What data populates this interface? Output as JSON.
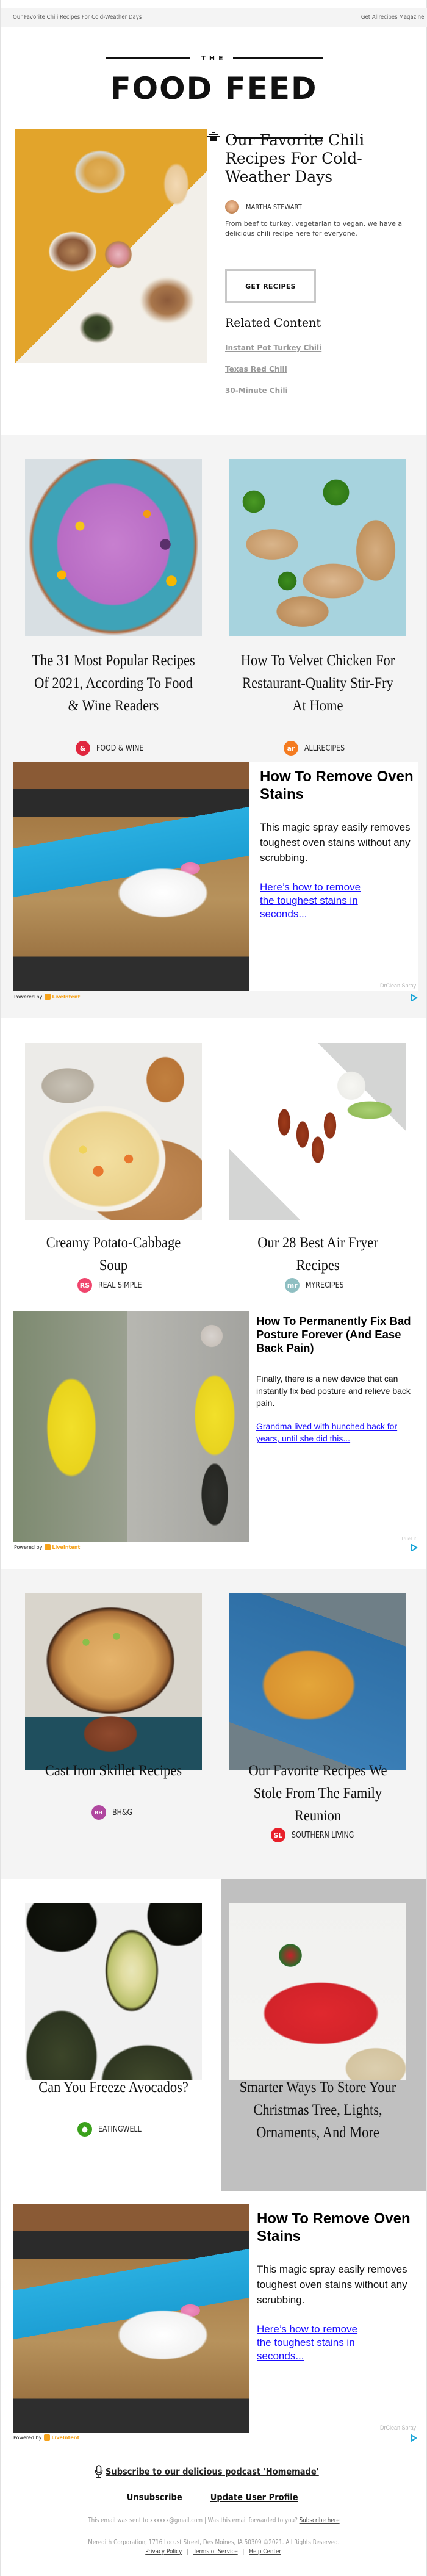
{
  "preheader": {
    "left_link": "Our Favorite Chili Recipes For Cold-Weather Days",
    "right_link": "Get Allrecipes Magazine"
  },
  "logo": {
    "the": "THE",
    "title": "FOOD FEED",
    "icon": "cooking-pot-icon"
  },
  "hero": {
    "title": "Our Favorite Chili Recipes For Cold-Weather Days",
    "author": "MARTHA STEWART",
    "description": "From beef to turkey, vegetarian to vegan, we have a delicious chili recipe here for everyone.",
    "cta": "GET RECIPES",
    "related_title": "Related Content",
    "related_links": [
      "Instant Pot Turkey Chili",
      "Texas Red Chili",
      "30-Minute Chili"
    ]
  },
  "cards": [
    {
      "title": "The 31 Most Popular Recipes Of 2021, According To Food & Wine Readers",
      "source": "FOOD & WINE",
      "source_icon_text": "&",
      "source_color": "#e0263e"
    },
    {
      "title": "How To Velvet Chicken For Restaurant-Quality Stir-Fry At Home",
      "source": "ALLRECIPES",
      "source_icon_text": "ar",
      "source_color": "#f47b20"
    },
    {
      "title": "Creamy Potato-Cabbage Soup",
      "source": "REAL SIMPLE",
      "source_icon_text": "RS",
      "source_color": "#f0456d"
    },
    {
      "title": "Our 28 Best Air Fryer Recipes",
      "source": "MYRECIPES",
      "source_icon_text": "mr",
      "source_color": "#8fbfc2"
    },
    {
      "title": "Cast Iron Skillet Recipes",
      "source": "BH&G",
      "source_icon_text": "BH",
      "source_color": "#b0479f"
    },
    {
      "title": "Our Favorite Recipes We Stole From The Family Reunion",
      "source": "SOUTHERN LIVING",
      "source_icon_text": "SL",
      "source_color": "#e8202a"
    },
    {
      "title": "Can You Freeze Avocados?",
      "source": "EATINGWELL",
      "source_icon_text": "●",
      "source_color": "#3aa11b"
    },
    {
      "title": "Smarter Ways To Store Your Christmas Tree, Lights, Ornaments, And More",
      "source": "",
      "source_icon_text": "",
      "source_color": ""
    }
  ],
  "ads": [
    {
      "headline": "How To Remove Oven Stains",
      "body": "This magic spray easily removes toughest oven stains without any scrubbing.",
      "link": "Here’s how to remove the toughest stains in seconds...",
      "sponsor": "DrClean Spray",
      "powered_by": "Powered by",
      "network": "LiveIntent"
    },
    {
      "headline": "How To Permanently Fix Bad Posture Forever (And Ease Back Pain)",
      "body": "Finally, there is a new device that can instantly fix bad posture and relieve back pain.",
      "link": "Grandma lived with hunched back for years, until she did this...",
      "sponsor": "TrueFit",
      "powered_by": "Powered by",
      "network": "LiveIntent"
    },
    {
      "headline": "How To Remove Oven Stains",
      "body": "This magic spray easily removes toughest oven stains without any scrubbing.",
      "link": "Here’s how to remove the toughest stains in seconds...",
      "sponsor": "DrClean Spray",
      "powered_by": "Powered by",
      "network": "LiveIntent"
    }
  ],
  "footer": {
    "podcast": "Subscribe to our delicious podcast 'Homemade'",
    "unsubscribe": "Unsubscribe",
    "update_profile": "Update User Profile",
    "sent_to_prefix": "This email was sent to xxxxxx@gmail.com  |  Was this email forwarded to you?",
    "subscribe_here": "Subscribe here",
    "address": "Meredith Corporation, 1716 Locust Street, Des Moines, IA 50309 ©2021. All Rights Reserved.",
    "privacy": "Privacy Policy",
    "terms": "Terms of Service",
    "help": "Help Center",
    "sep": "|"
  }
}
